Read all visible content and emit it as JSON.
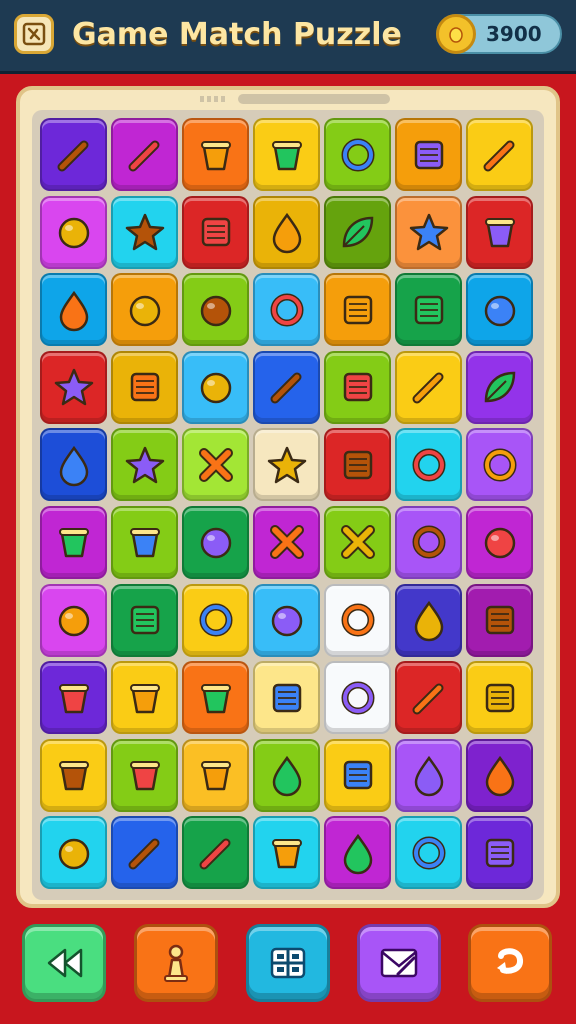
{
  "header": {
    "title": "Game Match Puzzle",
    "coins": "3900",
    "app_icon": "puzzle-logo-icon",
    "coin_icon": "gold-coin-icon"
  },
  "board": {
    "rows": [
      [
        {
          "icon": "bread-icon",
          "color": "#6d28d9"
        },
        {
          "icon": "pencil-icon",
          "color": "#c026d3"
        },
        {
          "icon": "jar-icon",
          "color": "#f97316"
        },
        {
          "icon": "cupcake-icon",
          "color": "#facc15"
        },
        {
          "icon": "spiral-icon",
          "color": "#84cc16"
        },
        {
          "icon": "crate-icon",
          "color": "#f59e0b"
        },
        {
          "icon": "bread-bundle-icon",
          "color": "#facc15"
        }
      ],
      [
        {
          "icon": "pepper-icon",
          "color": "#d946ef"
        },
        {
          "icon": "starfish-icon",
          "color": "#22d3ee"
        },
        {
          "icon": "notebook-icon",
          "color": "#dc2626"
        },
        {
          "icon": "drop-icon",
          "color": "#eab308"
        },
        {
          "icon": "leaf-icon",
          "color": "#65a30d"
        },
        {
          "icon": "crown-basket-icon",
          "color": "#fb923c"
        },
        {
          "icon": "pot-icon",
          "color": "#dc2626"
        }
      ],
      [
        {
          "icon": "garlic-icon",
          "color": "#0ea5e9"
        },
        {
          "icon": "face-icon",
          "color": "#f59e0b"
        },
        {
          "icon": "balloon-icon",
          "color": "#84cc16"
        },
        {
          "icon": "knot-icon",
          "color": "#38bdf8"
        },
        {
          "icon": "square-frame-icon",
          "color": "#f59e0b"
        },
        {
          "icon": "wooden-box-icon",
          "color": "#16a34a"
        },
        {
          "icon": "pumpkin-icon",
          "color": "#0ea5e9"
        }
      ],
      [
        {
          "icon": "sun-icon",
          "color": "#dc2626"
        },
        {
          "icon": "tv-icon",
          "color": "#eab308"
        },
        {
          "icon": "apple-icon",
          "color": "#38bdf8"
        },
        {
          "icon": "torch-icon",
          "color": "#2563eb"
        },
        {
          "icon": "book-icon",
          "color": "#84cc16"
        },
        {
          "icon": "shell-icon",
          "color": "#facc15"
        },
        {
          "icon": "seahorse-icon",
          "color": "#9333ea"
        }
      ],
      [
        {
          "icon": "ice-cream-icon",
          "color": "#1d4ed8"
        },
        {
          "icon": "flower-icon",
          "color": "#84cc16"
        },
        {
          "icon": "gem-icon",
          "color": "#a3e635"
        },
        {
          "icon": "star-icon",
          "color": "#f6e7bf"
        },
        {
          "icon": "mirror-icon",
          "color": "#dc2626"
        },
        {
          "icon": "glasses-icon",
          "color": "#22d3ee"
        },
        {
          "icon": "magnifier-icon",
          "color": "#a855f7"
        }
      ],
      [
        {
          "icon": "pie-icon",
          "color": "#c026d3"
        },
        {
          "icon": "bag-icon",
          "color": "#84cc16"
        },
        {
          "icon": "tomato-icon",
          "color": "#16a34a"
        },
        {
          "icon": "cross-sticks-icon",
          "color": "#c026d3"
        },
        {
          "icon": "x-icon",
          "color": "#84cc16"
        },
        {
          "icon": "ring-icon",
          "color": "#a855f7"
        },
        {
          "icon": "grapes-icon",
          "color": "#c026d3"
        }
      ],
      [
        {
          "icon": "cloud-icon",
          "color": "#d946ef"
        },
        {
          "icon": "books-stack-icon",
          "color": "#16a34a"
        },
        {
          "icon": "racket-icon",
          "color": "#facc15"
        },
        {
          "icon": "pumpkin-icon",
          "color": "#38bdf8"
        },
        {
          "icon": "target-icon",
          "color": "#f8fafc"
        },
        {
          "icon": "vase-icon",
          "color": "#4338ca"
        },
        {
          "icon": "eraser-icon",
          "color": "#a21caf"
        }
      ],
      [
        {
          "icon": "bucket-icon",
          "color": "#6d28d9"
        },
        {
          "icon": "mask-icon",
          "color": "#facc15"
        },
        {
          "icon": "lantern-icon",
          "color": "#f97316"
        },
        {
          "icon": "stamp-icon",
          "color": "#fde68a"
        },
        {
          "icon": "egg-icon",
          "color": "#f8fafc"
        },
        {
          "icon": "croissant-icon",
          "color": "#dc2626"
        },
        {
          "icon": "bandage-icon",
          "color": "#facc15"
        }
      ],
      [
        {
          "icon": "shield-icon",
          "color": "#facc15"
        },
        {
          "icon": "lucky-cat-icon",
          "color": "#84cc16"
        },
        {
          "icon": "hat-icon",
          "color": "#fbbf24"
        },
        {
          "icon": "popsicle-icon",
          "color": "#84cc16"
        },
        {
          "icon": "picture-icon",
          "color": "#facc15"
        },
        {
          "icon": "leaf-heart-icon",
          "color": "#a855f7"
        },
        {
          "icon": "pear-icon",
          "color": "#7e22ce"
        }
      ],
      [
        {
          "icon": "berry-icon",
          "color": "#22d3ee"
        },
        {
          "icon": "bell-pepper-icon",
          "color": "#2563eb"
        },
        {
          "icon": "banana-icon",
          "color": "#16a34a"
        },
        {
          "icon": "honey-pot-icon",
          "color": "#22d3ee"
        },
        {
          "icon": "flame-icon",
          "color": "#c026d3"
        },
        {
          "icon": "alarm-clock-icon",
          "color": "#22d3ee"
        },
        {
          "icon": "scroll-icon",
          "color": "#6d28d9"
        }
      ]
    ]
  },
  "toolbar": {
    "buttons": [
      {
        "name": "rewind-button",
        "icon": "rewind-icon",
        "color": "#4ade80"
      },
      {
        "name": "hint-button",
        "icon": "pawn-icon",
        "color": "#f97316"
      },
      {
        "name": "grid-button",
        "icon": "grid-icon",
        "color": "#22b8e0"
      },
      {
        "name": "mail-button",
        "icon": "envelope-icon",
        "color": "#a855f7"
      },
      {
        "name": "undo-button",
        "icon": "undo-icon",
        "color": "#f97316"
      }
    ]
  }
}
